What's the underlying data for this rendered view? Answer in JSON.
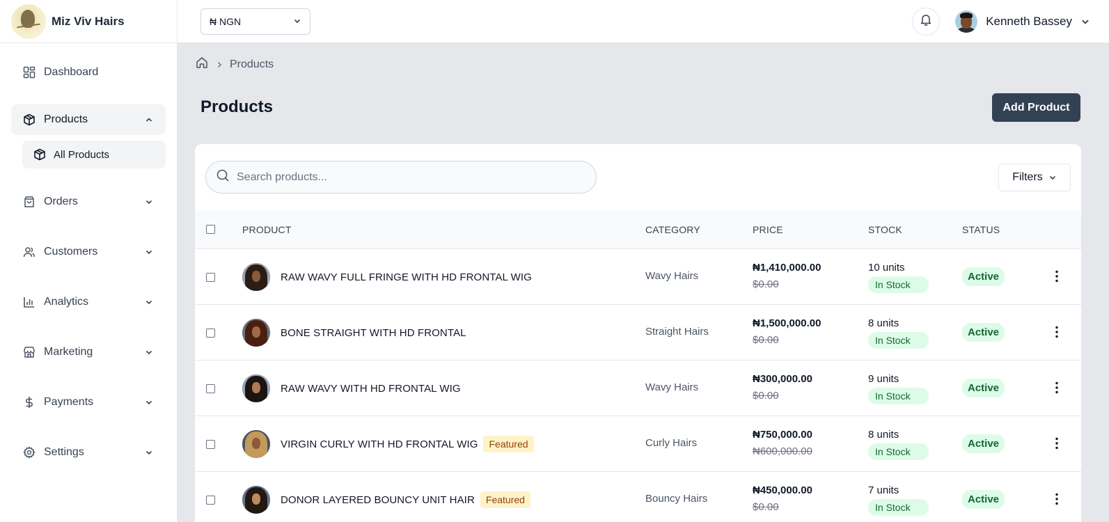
{
  "brand": {
    "name": "Miz Viv Hairs"
  },
  "sidebar": {
    "items": [
      {
        "label": "Dashboard",
        "icon": "dashboard-grid-icon"
      },
      {
        "label": "Products",
        "icon": "box-icon",
        "expanded": true
      },
      {
        "label": "All Products",
        "icon": "box-icon",
        "sub": true
      },
      {
        "label": "Orders",
        "icon": "shopping-bag-icon"
      },
      {
        "label": "Customers",
        "icon": "users-icon"
      },
      {
        "label": "Analytics",
        "icon": "bar-chart-icon"
      },
      {
        "label": "Marketing",
        "icon": "storefront-icon"
      },
      {
        "label": "Payments",
        "icon": "dollar-icon"
      },
      {
        "label": "Settings",
        "icon": "gear-icon"
      }
    ]
  },
  "topbar": {
    "currency": "₦ NGN",
    "user_name": "Kenneth Bassey"
  },
  "breadcrumb": {
    "current": "Products"
  },
  "page": {
    "title": "Products",
    "add_button": "Add Product"
  },
  "search": {
    "placeholder": "Search products..."
  },
  "filters": {
    "label": "Filters"
  },
  "table": {
    "headers": {
      "product": "PRODUCT",
      "category": "CATEGORY",
      "price": "PRICE",
      "stock": "STOCK",
      "status": "STATUS"
    },
    "rows": [
      {
        "name": "RAW WAVY FULL FRINGE WITH HD FRONTAL WIG",
        "featured": "",
        "category": "Wavy Hairs",
        "price": "₦1,410,000.00",
        "old_price": "$0.00",
        "units": "10 units",
        "stock_label": "In Stock",
        "status": "Active"
      },
      {
        "name": "BONE STRAIGHT WITH HD FRONTAL",
        "featured": "",
        "category": "Straight Hairs",
        "price": "₦1,500,000.00",
        "old_price": "$0.00",
        "units": "8 units",
        "stock_label": "In Stock",
        "status": "Active"
      },
      {
        "name": "RAW WAVY WITH HD FRONTAL WIG",
        "featured": "",
        "category": "Wavy Hairs",
        "price": "₦300,000.00",
        "old_price": "$0.00",
        "units": "9 units",
        "stock_label": "In Stock",
        "status": "Active"
      },
      {
        "name": "VIRGIN CURLY WITH HD FRONTAL WIG",
        "featured": "Featured",
        "category": "Curly Hairs",
        "price": "₦750,000.00",
        "old_price": "₦600,000.00",
        "units": "8 units",
        "stock_label": "In Stock",
        "status": "Active"
      },
      {
        "name": "DONOR LAYERED BOUNCY UNIT HAIR",
        "featured": "Featured",
        "category": "Bouncy Hairs",
        "price": "₦450,000.00",
        "old_price": "$0.00",
        "units": "7 units",
        "stock_label": "In Stock",
        "status": "Active"
      }
    ]
  },
  "colors": {
    "primary_button": "#334155",
    "active_badge_bg": "#dcfce7",
    "active_badge_text": "#166534",
    "featured_bg": "#fef3c7",
    "featured_text": "#92400e"
  }
}
